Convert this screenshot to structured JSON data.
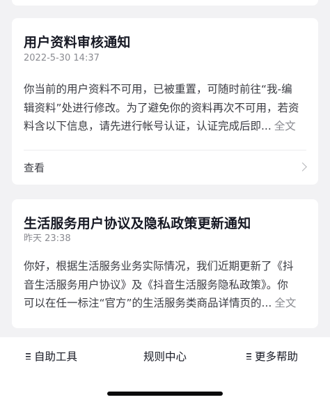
{
  "notices": [
    {
      "title": "用户资料审核通知",
      "time": "2022-5-30 14:37",
      "body_lines": [
        "你当前的用户资料不可用，已被重置，可随时前往“我-编",
        "辑资料”处进行修改。为了避免你的资料再次不可用，若资",
        "料含以下信息，请先进行帐号认证，认证完成后即..."
      ],
      "more_label": "全文",
      "view_label": "查看"
    },
    {
      "title": "生活服务用户协议及隐私政策更新通知",
      "time": "昨天 23:38",
      "body_lines": [
        "你好，根据生活服务业务实际情况，我们近期更新了《抖",
        "音生活服务用户协议》及《抖音生活服务隐私政策》。你",
        "可以在任一标注“官方”的生活服务类商品详情页的..."
      ],
      "more_label": "全文"
    }
  ],
  "bottom_bar": {
    "items": [
      {
        "label": "自助工具",
        "icon": "menu-icon"
      },
      {
        "label": "规则中心"
      },
      {
        "label": "更多帮助",
        "icon": "menu-icon"
      }
    ]
  }
}
